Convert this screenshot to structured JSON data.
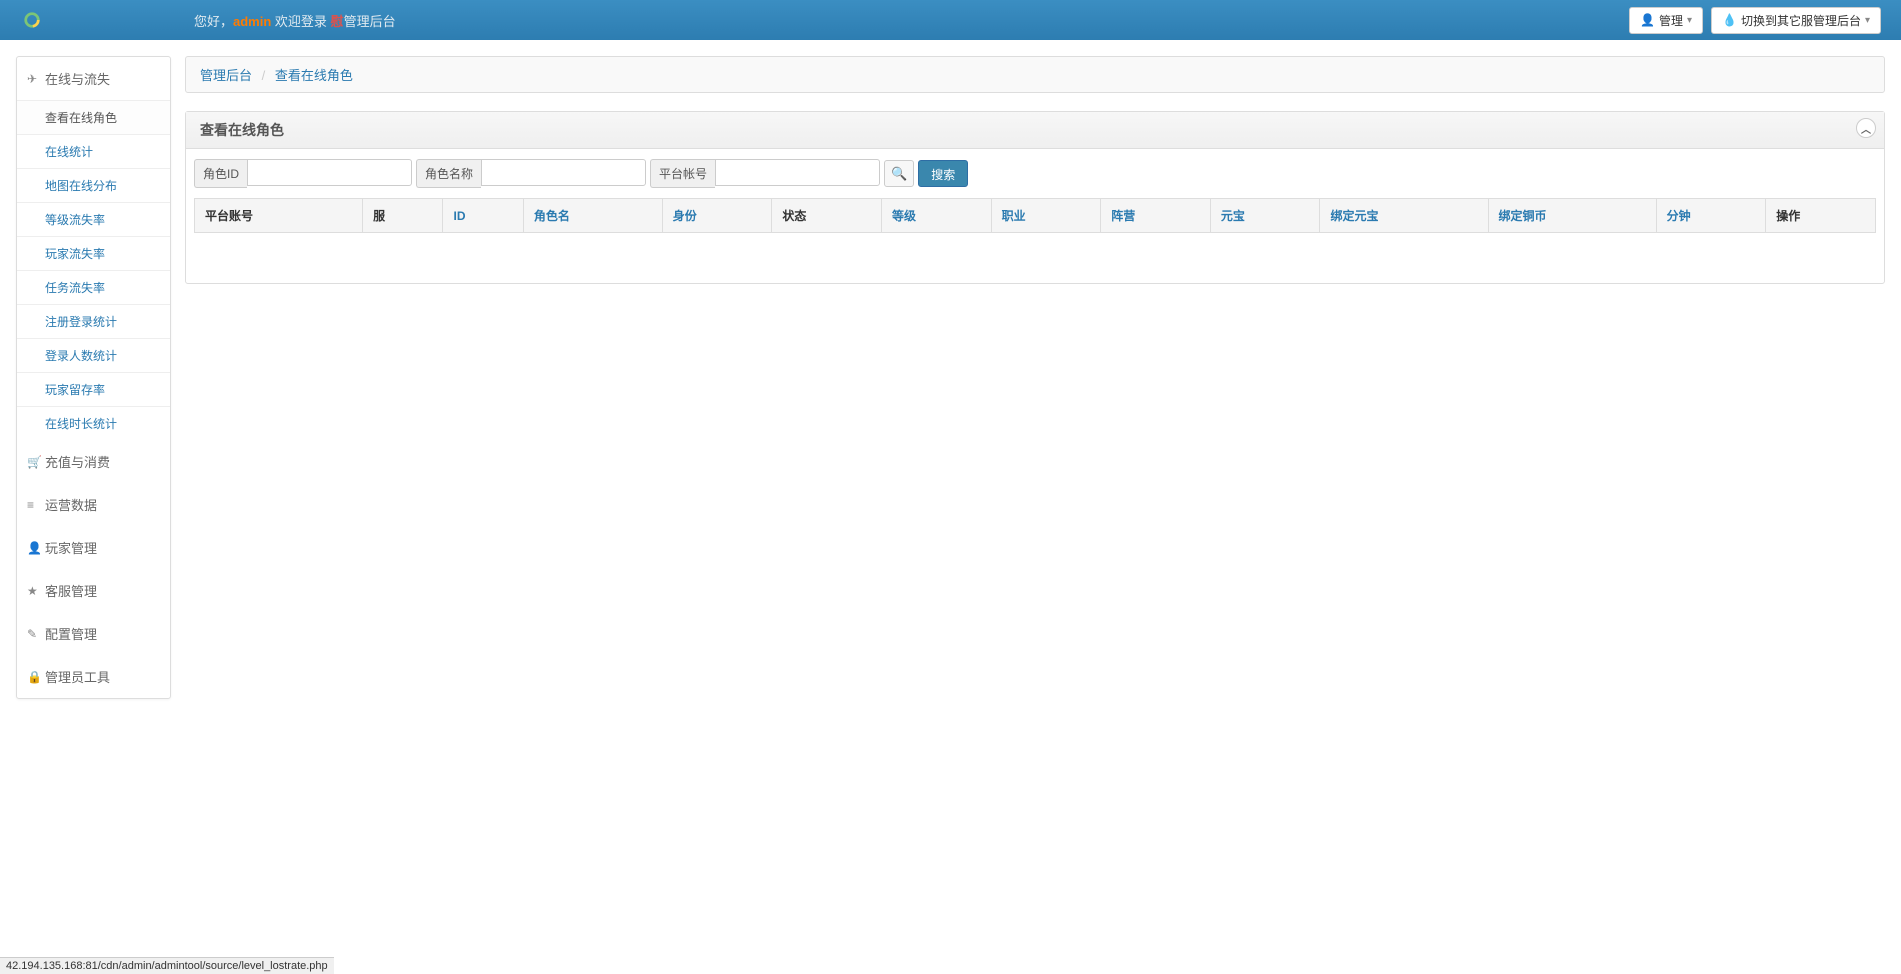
{
  "navbar": {
    "greeting_prefix": "您好，",
    "admin_user": "admin",
    "greeting_mid": " 欢迎登录 ",
    "highlight": "慰",
    "greeting_suffix": "管理后台",
    "admin_button": "管理",
    "switch_button": "切换到其它服管理后台"
  },
  "sidebar": {
    "sections": [
      {
        "label": "在线与流失",
        "icon": "plane",
        "open": true,
        "items": [
          {
            "label": "查看在线角色",
            "active": true
          },
          {
            "label": "在线统计"
          },
          {
            "label": "地图在线分布"
          },
          {
            "label": "等级流失率"
          },
          {
            "label": "玩家流失率"
          },
          {
            "label": "任务流失率"
          },
          {
            "label": "注册登录统计"
          },
          {
            "label": "登录人数统计"
          },
          {
            "label": "玩家留存率"
          },
          {
            "label": "在线时长统计"
          }
        ]
      },
      {
        "label": "充值与消费",
        "icon": "cart"
      },
      {
        "label": "运营数据",
        "icon": "list"
      },
      {
        "label": "玩家管理",
        "icon": "user"
      },
      {
        "label": "客服管理",
        "icon": "star"
      },
      {
        "label": "配置管理",
        "icon": "edit"
      },
      {
        "label": "管理员工具",
        "icon": "lock"
      }
    ]
  },
  "breadcrumb": {
    "root": "管理后台",
    "current": "查看在线角色"
  },
  "panel": {
    "title": "查看在线角色"
  },
  "search": {
    "role_id_label": "角色ID",
    "role_name_label": "角色名称",
    "account_label": "平台帐号",
    "button": "搜索"
  },
  "table": {
    "headers": [
      {
        "label": "平台账号",
        "sortable": false
      },
      {
        "label": "服",
        "sortable": false
      },
      {
        "label": "ID",
        "sortable": true
      },
      {
        "label": "角色名",
        "sortable": true
      },
      {
        "label": "身份",
        "sortable": true
      },
      {
        "label": "状态",
        "sortable": false
      },
      {
        "label": "等级",
        "sortable": true
      },
      {
        "label": "职业",
        "sortable": true
      },
      {
        "label": "阵营",
        "sortable": true
      },
      {
        "label": "元宝",
        "sortable": true
      },
      {
        "label": "绑定元宝",
        "sortable": true
      },
      {
        "label": "绑定铜币",
        "sortable": true
      },
      {
        "label": "分钟",
        "sortable": true
      },
      {
        "label": "操作",
        "sortable": false
      }
    ]
  },
  "status_bar": "42.194.135.168:81/cdn/admin/admintool/source/level_lostrate.php"
}
